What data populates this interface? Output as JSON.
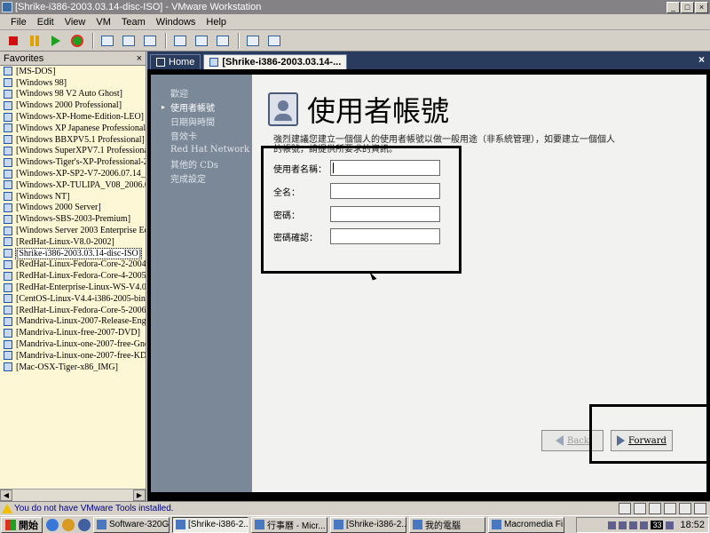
{
  "window": {
    "title": "[Shrike-i386-2003.03.14-disc-ISO] - VMware Workstation",
    "controls": [
      "_",
      "□",
      "×"
    ]
  },
  "menu": [
    "File",
    "Edit",
    "View",
    "VM",
    "Team",
    "Windows",
    "Help"
  ],
  "toolbar_icons": [
    "power-off-icon",
    "pause-icon",
    "power-on-icon",
    "reset-icon",
    "snapshot-icon",
    "revert-icon",
    "snapshot-manager-icon",
    "summary-view-icon",
    "console-view-icon",
    "fullscreen-icon",
    "quick-switch-icon",
    "team-icon"
  ],
  "favorites": {
    "title": "Favorites",
    "items": [
      "[MS-DOS]",
      "[Windows 98]",
      "[Windows 98 V2 Auto Ghost]",
      "[Windows 2000 Professional]",
      "[Windows-XP-Home-Edition-LEO]",
      "[Windows XP Japanese Professional]",
      "[Windows BBXPV5.1 Professional]",
      "[Windows SuperXPV7.1 Professional]",
      "[Windows-Tiger's-XP-Professional-20",
      "[Windows-XP-SP2-V7-2006.07.14_IS",
      "[Windows-XP-TULIPA_V08_2006.08",
      "[Windows NT]",
      "[Windows 2000 Server]",
      "[Windows-SBS-2003-Premium]",
      "[Windows Server 2003 Enterprise Edit",
      "[RedHat-Linux-V8.0-2002]",
      "[Shrike-i386-2003.03.14-disc-ISO]",
      "[RedHat-Linux-Fedora-Core-2-2004]",
      "[RedHat-Linux-Fedora-Core-4-2005]",
      "[RedHat-Enterprise-Linux-WS-V4.0-2",
      "[CentOS-Linux-V4.4-i386-2005-bin1-",
      "[RedHat-Linux-Fedora-Core-5-2006-i",
      "[Mandriva-Linux-2007-Release-Eng-C",
      "[Mandriva-Linux-free-2007-DVD]",
      "[Mandriva-Linux-one-2007-free-Gnon",
      "[Mandriva-Linux-one-2007-free-KDE]",
      "[Mac-OSX-Tiger-x86_IMG]"
    ],
    "selected_index": 16
  },
  "tabs": {
    "home": "Home",
    "vm": "[Shrike-i386-2003.03.14-..."
  },
  "installer": {
    "steps": [
      "歡迎",
      "使用者帳號",
      "日期與時間",
      "音效卡",
      "Red Hat Network",
      "其他的 CDs",
      "完成設定"
    ],
    "current_step": 1,
    "title": "使用者帳號",
    "description": "強烈建議您建立一個個人的使用者帳號以做一般用途（非系統管理），如要建立一個個人的帳號，請提供所要求的資訊。",
    "fields": [
      {
        "label": "使用者名稱：",
        "value": ""
      },
      {
        "label": "全名：",
        "value": ""
      },
      {
        "label": "密碼：",
        "value": ""
      },
      {
        "label": "密碼確認：",
        "value": ""
      }
    ],
    "back_label": "Back",
    "forward_label": "Forward"
  },
  "status": {
    "text": "You do not have VMware Tools installed."
  },
  "taskbar": {
    "start": "開始",
    "tasks": [
      "Software-320G...",
      "[Shrike-i386-2...",
      "行事曆 - Micr...",
      "[Shrike-i386-2...",
      "我的電腦",
      "Macromedia Fi..."
    ],
    "active_task": 1,
    "badge": "33",
    "clock": "18:52"
  }
}
